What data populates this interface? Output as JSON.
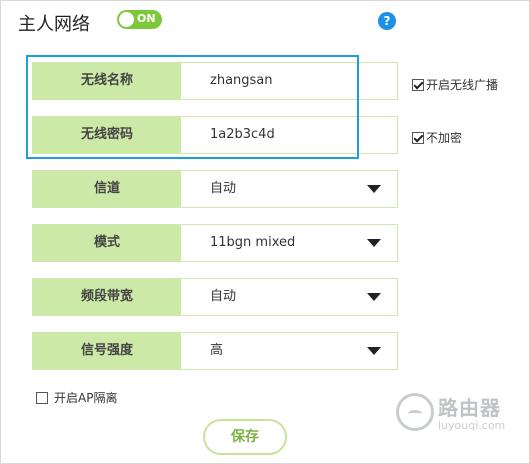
{
  "header": {
    "title": "主人网络",
    "toggle_label": "ON",
    "help_label": "?"
  },
  "fields": [
    {
      "label": "无线名称",
      "value": "zhangsan"
    },
    {
      "label": "无线密码",
      "value": "1a2b3c4d"
    }
  ],
  "selects": [
    {
      "label": "信道",
      "value": "自动"
    },
    {
      "label": "模式",
      "value": "11bgn mixed"
    },
    {
      "label": "频段带宽",
      "value": "自动"
    },
    {
      "label": "信号强度",
      "value": "高"
    }
  ],
  "checkboxes": {
    "broadcast": {
      "label": "开启无线广播",
      "checked": true
    },
    "no_encrypt": {
      "label": "不加密",
      "checked": true
    },
    "ap_isolation": {
      "label": "开启AP隔离",
      "checked": false
    }
  },
  "save_label": "保存",
  "watermark": {
    "cn": "路由器",
    "en": "luyouqi.com"
  },
  "colors": {
    "accent_green": "#7dc83a",
    "label_bg": "#cde9a7",
    "highlight_blue": "#1e9fd7"
  }
}
